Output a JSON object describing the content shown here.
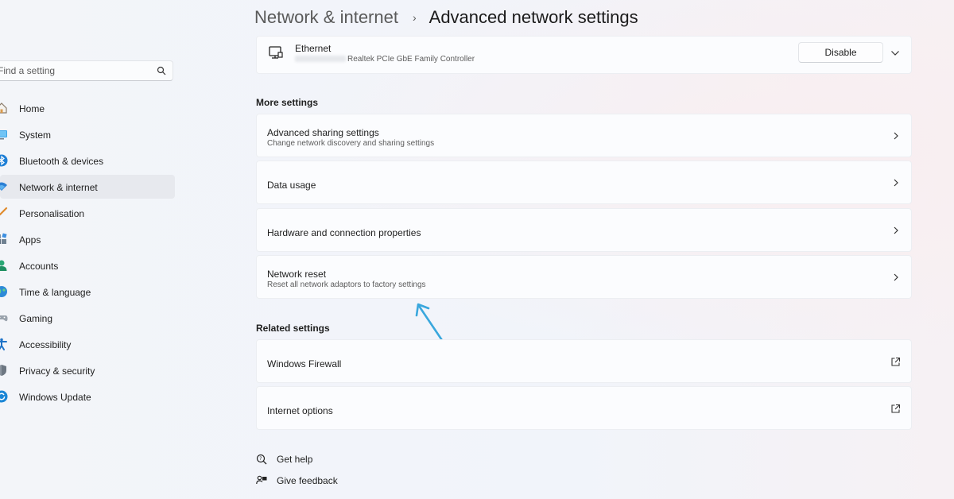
{
  "header": {
    "parent": "Network & internet",
    "separator": "›",
    "current": "Advanced network settings"
  },
  "search": {
    "placeholder": "Find a setting"
  },
  "sidebar": {
    "items": [
      {
        "label": "Home",
        "icon": "home-icon"
      },
      {
        "label": "System",
        "icon": "system-icon"
      },
      {
        "label": "Bluetooth & devices",
        "icon": "bluetooth-icon"
      },
      {
        "label": "Network & internet",
        "icon": "wifi-icon",
        "selected": true
      },
      {
        "label": "Personalisation",
        "icon": "brush-icon"
      },
      {
        "label": "Apps",
        "icon": "apps-icon"
      },
      {
        "label": "Accounts",
        "icon": "account-icon"
      },
      {
        "label": "Time & language",
        "icon": "globe-icon"
      },
      {
        "label": "Gaming",
        "icon": "gamepad-icon"
      },
      {
        "label": "Accessibility",
        "icon": "accessibility-icon"
      },
      {
        "label": "Privacy & security",
        "icon": "shield-icon"
      },
      {
        "label": "Windows Update",
        "icon": "update-icon"
      }
    ]
  },
  "adapter": {
    "name": "Ethernet",
    "description": "Realtek PCIe GbE Family Controller",
    "disable_label": "Disable",
    "icon": "ethernet-icon"
  },
  "more_settings": {
    "label": "More settings",
    "items": [
      {
        "title": "Advanced sharing settings",
        "subtitle": "Change network discovery and sharing settings"
      },
      {
        "title": "Data usage"
      },
      {
        "title": "Hardware and connection properties"
      },
      {
        "title": "Network reset",
        "subtitle": "Reset all network adaptors to factory settings"
      }
    ]
  },
  "related_settings": {
    "label": "Related settings",
    "items": [
      {
        "title": "Windows Firewall",
        "icon": "external-link-icon"
      },
      {
        "title": "Internet options",
        "icon": "external-link-icon"
      }
    ]
  },
  "footer": {
    "help": "Get help",
    "feedback": "Give feedback"
  },
  "colors": {
    "accent": "#0067c0",
    "annotation_arrow": "#3aa7dd",
    "selected_nav": "#e7e9ee"
  }
}
